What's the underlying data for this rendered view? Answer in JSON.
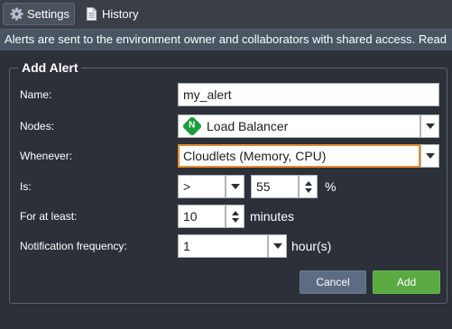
{
  "tabs": {
    "settings": {
      "label": "Settings",
      "icon": "gear-icon"
    },
    "history": {
      "label": "History",
      "icon": "document-icon"
    }
  },
  "banner_text": "Alerts are sent to the environment owner and collaborators with shared access. Read",
  "form": {
    "legend": "Add Alert",
    "name": {
      "label": "Name:",
      "value": "my_alert"
    },
    "nodes": {
      "label": "Nodes:",
      "value": "Load Balancer",
      "icon": "nginx-icon",
      "icon_letter": "N"
    },
    "whenever": {
      "label": "Whenever:",
      "value": "Cloudlets (Memory, CPU)"
    },
    "is": {
      "label": "Is:",
      "operator": ">",
      "value": "55",
      "unit": "%"
    },
    "for_at_least": {
      "label": "For at least:",
      "value": "10",
      "unit": "minutes"
    },
    "frequency": {
      "label": "Notification frequency:",
      "value": "1",
      "unit": "hour(s)"
    }
  },
  "buttons": {
    "cancel": "Cancel",
    "add": "Add"
  },
  "colors": {
    "background": "#2c3139",
    "tabbar": "#3a3f47",
    "banner": "#485563",
    "focus_border": "#e58a2e",
    "add_button": "#5aa941",
    "cancel_button": "#5d6b83",
    "nginx_green": "#1b9e3a"
  }
}
